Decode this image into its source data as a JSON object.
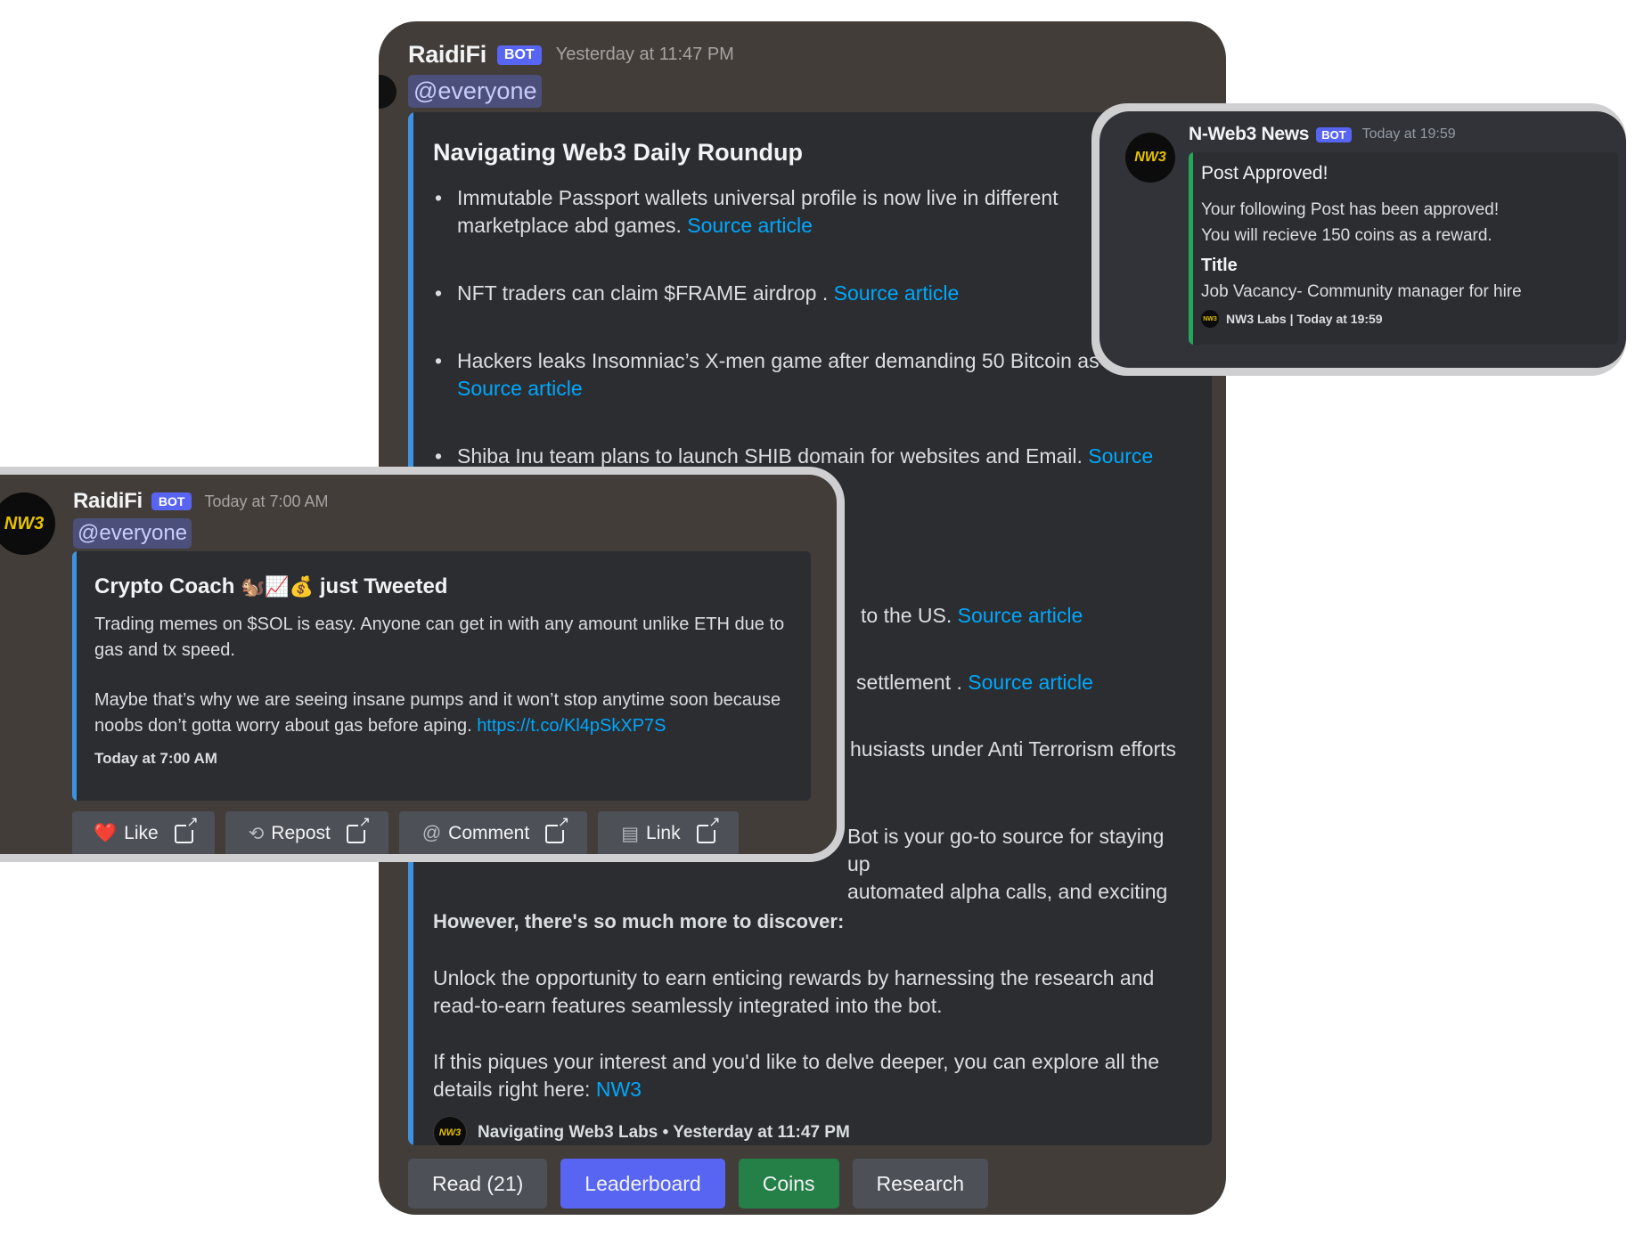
{
  "main": {
    "username": "RaidiFi",
    "bot_tag": "BOT",
    "timestamp": "Yesterday at 11:47 PM",
    "mention": "@everyone",
    "embed": {
      "title": "Navigating Web3 Daily Roundup",
      "bullets": [
        {
          "text": "Immutable Passport wallets universal profile is now live in different",
          "text2": "marketplace abd games.",
          "link": "Source article"
        },
        {
          "text": "NFT traders can claim $FRAME airdrop .",
          "link": "Source article"
        },
        {
          "text": "Hackers leaks Insomniac’s X-men game after demanding 50 Bitcoin as ransom.",
          "link": "Source article"
        },
        {
          "text": "Shiba Inu team plans to launch SHIB domain for websites and Email.",
          "link": "Source"
        },
        {
          "text": "to the US.",
          "link": "Source article"
        },
        {
          "text": "settlement .",
          "link": "Source article"
        },
        {
          "text": "husiasts under Anti Terrorism efforts"
        }
      ],
      "partial_para_line1": "Bot is your go-to source for staying up",
      "partial_para_line2": "automated alpha calls, and exciting",
      "more_heading": "However, there's so much more to discover:",
      "para1": "Unlock the opportunity to earn enticing rewards by harnessing the research and read-to-earn features seamlessly integrated into the bot.",
      "para2": "If this piques your interest and you'd like to delve deeper, you can explore all the details right here:",
      "para2_link": "NW3",
      "footer": "Navigating Web3 Labs • Yesterday at 11:47 PM",
      "footer_icon": "NW3"
    },
    "buttons": {
      "read": "Read (21)",
      "leaderboard": "Leaderboard",
      "coins": "Coins",
      "research": "Research"
    }
  },
  "tweet_card": {
    "username": "RaidiFi",
    "bot_tag": "BOT",
    "timestamp": "Today at 7:00 AM",
    "mention": "@everyone",
    "avatar_text": "NW3",
    "title_prefix": "Crypto Coach",
    "title_emojis": "🐿️📈💰",
    "title_suffix": "just Tweeted",
    "body1": "Trading memes on $SOL is easy. Anyone can get in with any amount unlike ETH due to gas and tx speed.",
    "body2": "Maybe that’s why we are seeing insane pumps and it won’t stop anytime soon because noobs don’t gotta worry about gas before aping.",
    "body2_link": "https://t.co/Kl4pSkXP7S",
    "embed_timestamp": "Today at 7:00 AM",
    "buttons": [
      {
        "label": "Like",
        "icon": "❤️"
      },
      {
        "label": "Repost",
        "icon": "⟲"
      },
      {
        "label": "Comment",
        "icon": "@"
      },
      {
        "label": "Link",
        "icon": "▤"
      }
    ]
  },
  "news_card": {
    "username": "N-Web3 News",
    "bot_tag": "BOT",
    "timestamp": "Today at 19:59",
    "avatar_text": "NW3",
    "title": "Post Approved!",
    "text1": "Your following Post has been approved!",
    "text2": "You will recieve 150 coins as a reward.",
    "field_name": "Title",
    "field_value": "Job Vacancy- Community manager for hire",
    "footer": "NW3 Labs | Today at 19:59",
    "footer_icon": "NW3",
    "accent": "#23a55a"
  }
}
